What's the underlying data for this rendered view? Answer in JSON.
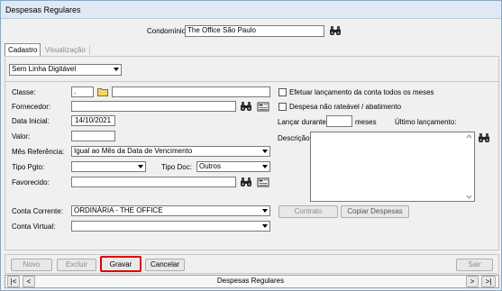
{
  "window": {
    "title": "Despesas Regulares"
  },
  "condominio": {
    "label": "Condomínio:",
    "value": "The Office São Paulo"
  },
  "tabs": [
    {
      "label": "Cadastro",
      "active": true
    },
    {
      "label": "Visualização",
      "active": false
    }
  ],
  "linha_digitavel": {
    "value": "Sem Linha Digitável"
  },
  "form": {
    "classe_label": "Classe:",
    "classe_code": ".",
    "fornecedor_label": "Fornecedor:",
    "data_inicial_label": "Data Inicial:",
    "data_inicial_value": "14/10/2021",
    "valor_label": "Valor:",
    "mes_referencia_label": "Mês Referência:",
    "mes_referencia_value": "Igual ao Mês da Data de Vencimento",
    "tipo_pgto_label": "Tipo Pgto:",
    "tipo_doc_label": "Tipo Doc:",
    "tipo_doc_value": "Outros",
    "favorecido_label": "Favorecido:",
    "conta_corrente_label": "Conta Corrente:",
    "conta_corrente_value": "ORDINÁRIA - THE OFFICE",
    "conta_virtual_label": "Conta Virtual:"
  },
  "options": {
    "efetuar_label": "Efetuar lançamento da conta todos os meses",
    "nao_rateavel_label": "Despesa não rateável / abatimento",
    "lancar_durante_label": "Lançar durante:",
    "meses_label": "meses",
    "ultimo_lancamento_label": "Último lançamento:",
    "descricao_label": "Descrição:"
  },
  "actions": {
    "contrato": "Contrato",
    "copiar_despesas": "Copiar Despesas"
  },
  "toolbar": {
    "novo": "Novo",
    "excluir": "Excluir",
    "gravar": "Gravar",
    "cancelar": "Cancelar",
    "sair": "Sair"
  },
  "navigator": {
    "first": "|<",
    "prev": "<",
    "label": "Despesas Regulares",
    "next": ">",
    "last": ">|"
  },
  "colors": {
    "highlight": "#e00000",
    "titlebar": "#dfe9f5"
  },
  "icons": [
    "binoculars-icon",
    "folder-icon",
    "register-icon",
    "chevron-up-icon",
    "chevron-down-icon"
  ]
}
